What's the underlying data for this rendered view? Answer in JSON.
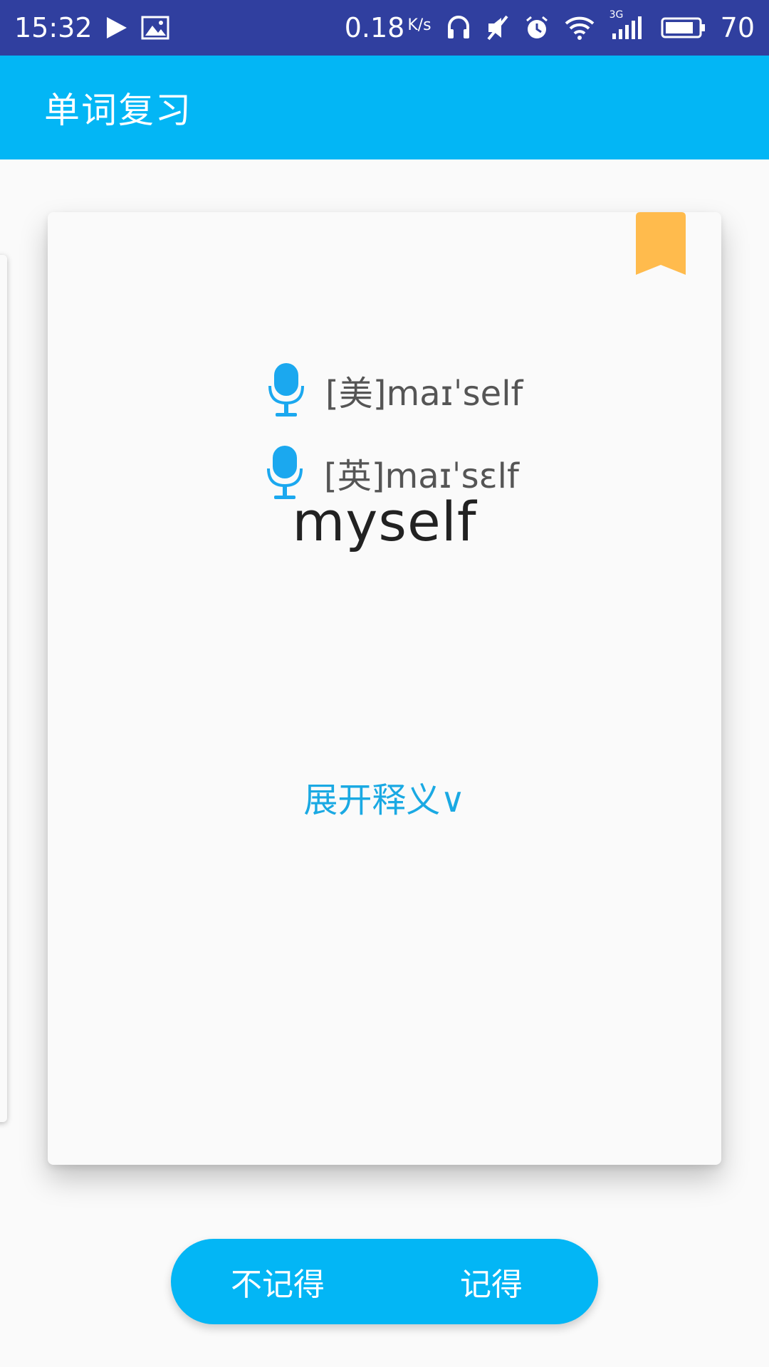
{
  "status_bar": {
    "time": "15:32",
    "speed": "0.18",
    "speed_unit": "K/s",
    "network": "3G",
    "battery": "70"
  },
  "app_bar": {
    "title": "单词复习"
  },
  "card": {
    "word": "myself",
    "us_phonetic": "[美]maɪˈself",
    "uk_phonetic": "[英]maɪˈsɛlf",
    "expand_label": "展开释义∨"
  },
  "buttons": {
    "forgot_label": "不记得",
    "remember_label": "记得"
  },
  "colors": {
    "status_bar": "#303f9f",
    "primary": "#03b6f5",
    "bookmark": "#ffbb4d",
    "mic": "#1ba8ef"
  }
}
